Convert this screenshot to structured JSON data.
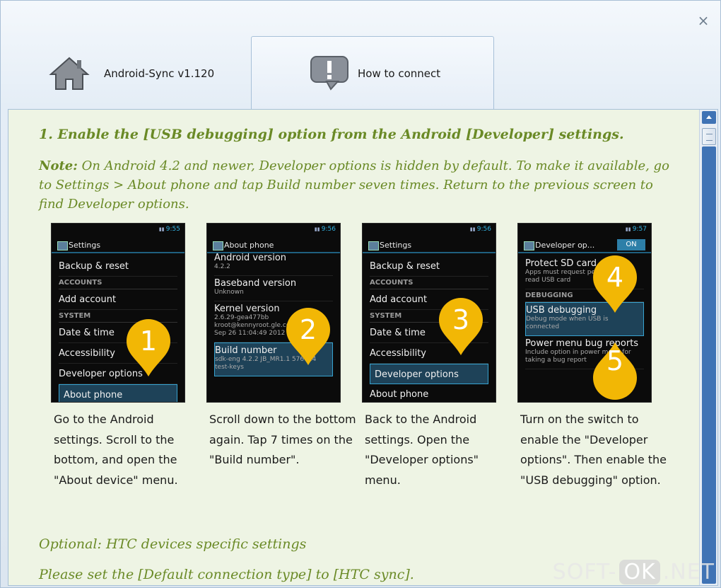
{
  "window": {
    "close_symbol": "×"
  },
  "tabs": [
    {
      "label": "Android-Sync v1.120",
      "icon": "home-icon"
    },
    {
      "label": "How to connect",
      "icon": "alert-bubble-icon"
    }
  ],
  "content": {
    "heading": "1. Enable the [USB debugging] option from the Android [Developer] settings.",
    "note_label": "Note:",
    "note_text": " On Android 4.2 and newer, Developer options is hidden by default. To make it available, go to Settings > About phone and tap Build number seven times. Return to the previous screen to find Developer options.",
    "optional_title": "Optional: HTC devices specific settings",
    "optional_text": "Please set the [Default connection type] to [HTC sync]."
  },
  "steps": [
    {
      "screen": {
        "time": "9:55",
        "title": "Settings",
        "items": [
          "Backup & reset",
          "ACCOUNTS",
          "Add account",
          "SYSTEM",
          "Date & time",
          "Accessibility",
          "Developer options",
          "About phone"
        ]
      },
      "badge": "1",
      "caption": "Go to the Android settings. Scroll to the bottom, and open the \"About device\" menu."
    },
    {
      "screen": {
        "time": "9:56",
        "title": "About phone",
        "items": [
          {
            "main": "Android version",
            "sub": "4.2.2"
          },
          {
            "main": "Baseband version",
            "sub": "Unknown"
          },
          {
            "main": "Kernel version",
            "sub": "2.6.29-gea477bb kroot@kennyroot.gle.com #1 Wed Sep 26 11:04:49 2012"
          },
          {
            "main": "Build number",
            "sub": "sdk-eng 4.2.2 JB_MR1.1 576024 test-keys"
          }
        ]
      },
      "badge": "2",
      "caption": "Scroll down to the bottom again. Tap 7 times on the \"Build number\"."
    },
    {
      "screen": {
        "time": "9:56",
        "title": "Settings",
        "items": [
          "Backup & reset",
          "ACCOUNTS",
          "Add account",
          "SYSTEM",
          "Date & time",
          "Accessibility",
          "Developer options",
          "About phone"
        ]
      },
      "badge": "3",
      "caption": "Back to the Android settings. Open the \"Developer options\" menu."
    },
    {
      "screen": {
        "time": "9:57",
        "title": "Developer op...",
        "toggle": "ON",
        "items": [
          {
            "main": "Protect SD card",
            "sub": "Apps must request permission to read USB card"
          },
          {
            "main": "DEBUGGING",
            "sub": ""
          },
          {
            "main": "USB debugging",
            "sub": "Debug mode when USB is connected"
          },
          {
            "main": "Power menu bug reports",
            "sub": "Include option in power menu for taking a bug report"
          }
        ]
      },
      "badges": [
        "4",
        "5"
      ],
      "caption": "Turn on the switch to enable the \"Developer options\". Then enable the \"USB debugging\" option."
    }
  ],
  "watermark": {
    "left": "SOFT-",
    "mid": "OK",
    "right": ".NET"
  },
  "colors": {
    "accent_green": "#6a8a26",
    "pin_yellow": "#f2b705",
    "android_blue": "#37a3d0"
  }
}
